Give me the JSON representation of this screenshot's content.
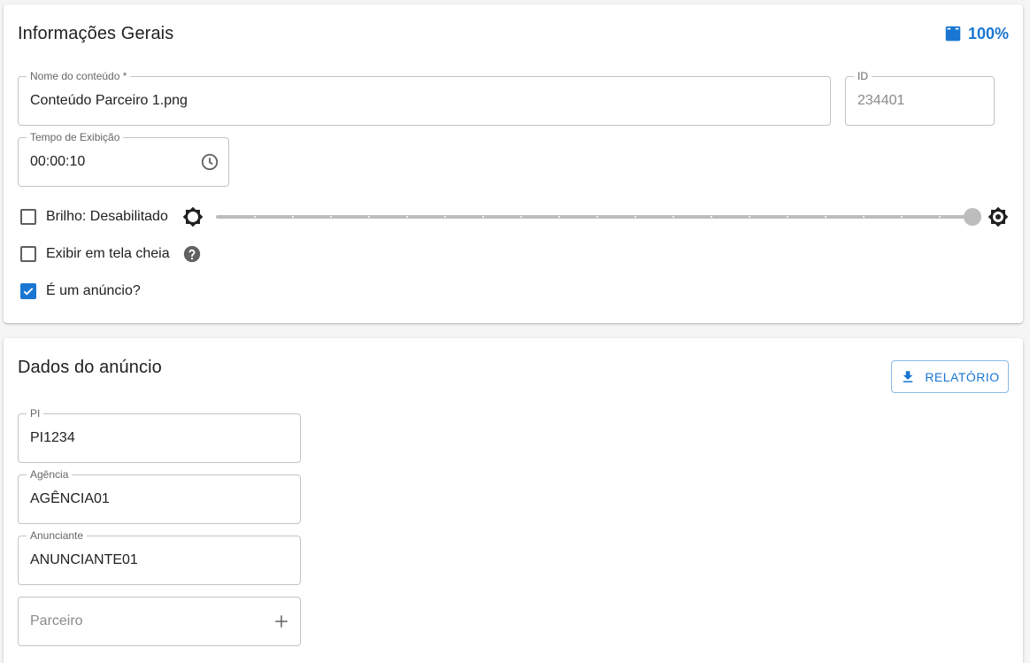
{
  "general": {
    "title": "Informações Gerais",
    "download_percent": "100%",
    "content_name": {
      "label": "Nome do conteúdo *",
      "value": "Conteúdo Parceiro 1.png"
    },
    "id": {
      "label": "ID",
      "value": "234401"
    },
    "display_time": {
      "label": "Tempo de Exibição",
      "value": "00:00:10"
    },
    "brightness": {
      "label": "Brilho: Desabilitado",
      "checked": false,
      "level": 1.0
    },
    "fullscreen": {
      "label": "Exibir em tela cheia",
      "checked": false
    },
    "is_ad": {
      "label": "É um anúncio?",
      "checked": true
    }
  },
  "ad": {
    "title": "Dados do anúncio",
    "report_button": "RELATÓRIO",
    "pi": {
      "label": "PI",
      "value": "PI1234"
    },
    "agency": {
      "label": "Agência",
      "value": "AGÊNCIA01"
    },
    "advertiser": {
      "label": "Anunciante",
      "value": "ANUNCIANTE01"
    },
    "partner": {
      "placeholder": "Parceiro"
    }
  },
  "colors": {
    "accent": "#1976d2",
    "border": "#c4c4c4",
    "slider": "#bdbdbd"
  },
  "icons": [
    "download-icon",
    "clock-icon",
    "brightness-low-icon",
    "brightness-high-icon",
    "help-icon",
    "check-icon",
    "plus-icon"
  ]
}
